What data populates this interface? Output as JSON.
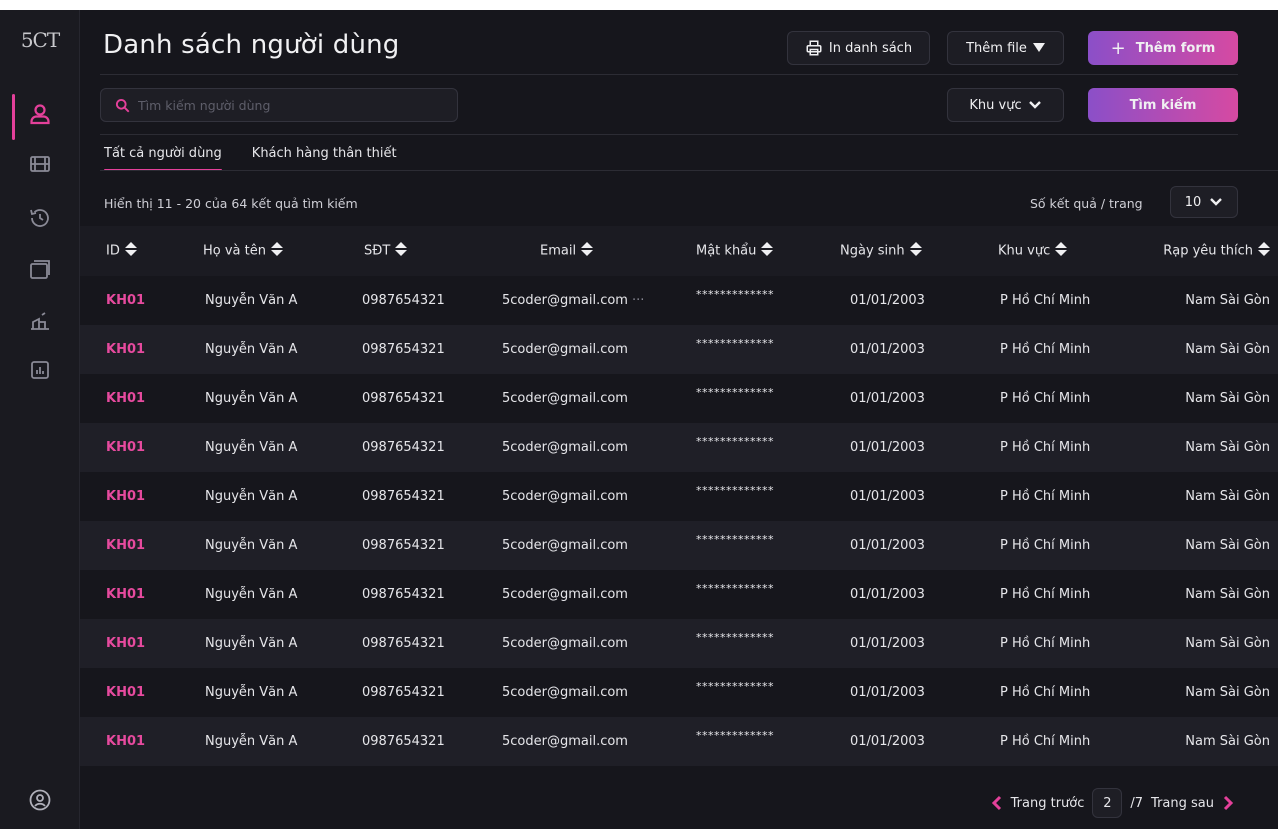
{
  "app": {
    "logo": "5CT"
  },
  "header": {
    "title": "Danh sách người dùng",
    "print_label": "In danh sách",
    "add_file_label": "Thêm file",
    "add_form_label": "Thêm form"
  },
  "search": {
    "placeholder": "Tìm kiếm người dùng",
    "region_label": "Khu vực",
    "submit_label": "Tìm kiếm"
  },
  "tabs": [
    {
      "label": "Tất cả người dùng",
      "active": true
    },
    {
      "label": "Khách hàng thân thiết",
      "active": false
    }
  ],
  "results": {
    "info": "Hiển thị 11 - 20 của 64 kết quả tìm kiếm",
    "per_page_label": "Số kết quả / trang",
    "per_page_value": "10"
  },
  "table": {
    "columns": [
      "ID",
      "Họ và tên",
      "SĐT",
      "Email",
      "Mật khẩu",
      "Ngày sinh",
      "Khu vực",
      "Rạp yêu thích"
    ],
    "rows": [
      {
        "id": "KH01",
        "name": "Nguyễn Văn A",
        "phone": "0987654321",
        "email": "5coder@gmail.com",
        "password": "*************",
        "dob": "01/01/2003",
        "area": "P Hồ Chí Minh",
        "fav": "Nam Sài Gòn",
        "more": "···"
      },
      {
        "id": "KH01",
        "name": "Nguyễn Văn A",
        "phone": "0987654321",
        "email": "5coder@gmail.com",
        "password": "*************",
        "dob": "01/01/2003",
        "area": "P Hồ Chí Minh",
        "fav": "Nam Sài Gòn"
      },
      {
        "id": "KH01",
        "name": "Nguyễn Văn A",
        "phone": "0987654321",
        "email": "5coder@gmail.com",
        "password": "*************",
        "dob": "01/01/2003",
        "area": "P Hồ Chí Minh",
        "fav": "Nam Sài Gòn"
      },
      {
        "id": "KH01",
        "name": "Nguyễn Văn A",
        "phone": "0987654321",
        "email": "5coder@gmail.com",
        "password": "*************",
        "dob": "01/01/2003",
        "area": "P Hồ Chí Minh",
        "fav": "Nam Sài Gòn"
      },
      {
        "id": "KH01",
        "name": "Nguyễn Văn A",
        "phone": "0987654321",
        "email": "5coder@gmail.com",
        "password": "*************",
        "dob": "01/01/2003",
        "area": "P Hồ Chí Minh",
        "fav": "Nam Sài Gòn"
      },
      {
        "id": "KH01",
        "name": "Nguyễn Văn A",
        "phone": "0987654321",
        "email": "5coder@gmail.com",
        "password": "*************",
        "dob": "01/01/2003",
        "area": "P Hồ Chí Minh",
        "fav": "Nam Sài Gòn"
      },
      {
        "id": "KH01",
        "name": "Nguyễn Văn A",
        "phone": "0987654321",
        "email": "5coder@gmail.com",
        "password": "*************",
        "dob": "01/01/2003",
        "area": "P Hồ Chí Minh",
        "fav": "Nam Sài Gòn"
      },
      {
        "id": "KH01",
        "name": "Nguyễn Văn A",
        "phone": "0987654321",
        "email": "5coder@gmail.com",
        "password": "*************",
        "dob": "01/01/2003",
        "area": "P Hồ Chí Minh",
        "fav": "Nam Sài Gòn"
      },
      {
        "id": "KH01",
        "name": "Nguyễn Văn A",
        "phone": "0987654321",
        "email": "5coder@gmail.com",
        "password": "*************",
        "dob": "01/01/2003",
        "area": "P Hồ Chí Minh",
        "fav": "Nam Sài Gòn"
      },
      {
        "id": "KH01",
        "name": "Nguyễn Văn A",
        "phone": "0987654321",
        "email": "5coder@gmail.com",
        "password": "*************",
        "dob": "01/01/2003",
        "area": "P Hồ Chí Minh",
        "fav": "Nam Sài Gòn"
      }
    ]
  },
  "pagination": {
    "prev_label": "Trang trước",
    "current": "2",
    "total": "/7",
    "next_label": "Trang sau"
  },
  "icons": {
    "nav": [
      "user-icon",
      "film-icon",
      "history-icon",
      "calendar-icon",
      "ticket-icon",
      "chart-icon"
    ],
    "profile": "profile-circle-icon"
  },
  "colors": {
    "accent": "#e4409a",
    "gradient_start": "#8b4fc8",
    "gradient_end": "#d64aa2",
    "background": "#16161c",
    "row_alt": "#1f1f27"
  }
}
